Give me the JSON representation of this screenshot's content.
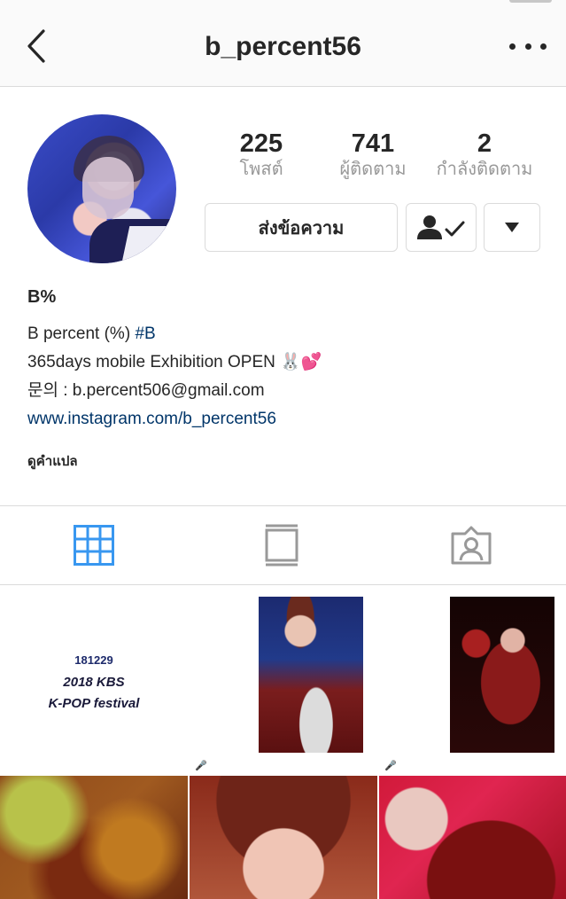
{
  "nav": {
    "title": "b_percent56",
    "back_icon": "chevron-left-icon",
    "more_icon": "more-horizontal-icon"
  },
  "profile": {
    "stats": [
      {
        "value": "225",
        "label": "โพสต์"
      },
      {
        "value": "741",
        "label": "ผู้ติดตาม"
      },
      {
        "value": "2",
        "label": "กำลังติดตาม"
      }
    ],
    "message_button": "ส่งข้อความ",
    "following_icon": "person-check-icon",
    "dropdown_icon": "triangle-down-icon"
  },
  "bio": {
    "name": "B%",
    "line1_text": "B percent (%) ",
    "line1_tag": "#B",
    "line2_text": "365days mobile Exhibition OPEN",
    "line2_emoji": "🐰💕",
    "line3_text": "문의 : b.percent506@gmail.com",
    "link": "www.instagram.com/b_percent56",
    "translate": "ดูคำแปล"
  },
  "tabs": [
    {
      "icon": "grid-icon",
      "active": true
    },
    {
      "icon": "feed-icon",
      "active": false
    },
    {
      "icon": "tagged-icon",
      "active": false
    }
  ],
  "posts": {
    "first": {
      "date": "181229",
      "title": "2018 KBS",
      "subtitle": "K-POP festival"
    }
  },
  "colors": {
    "accent_blue": "#3897f0",
    "link_blue": "#003569",
    "border": "#dbdbdb",
    "muted": "#999999"
  }
}
